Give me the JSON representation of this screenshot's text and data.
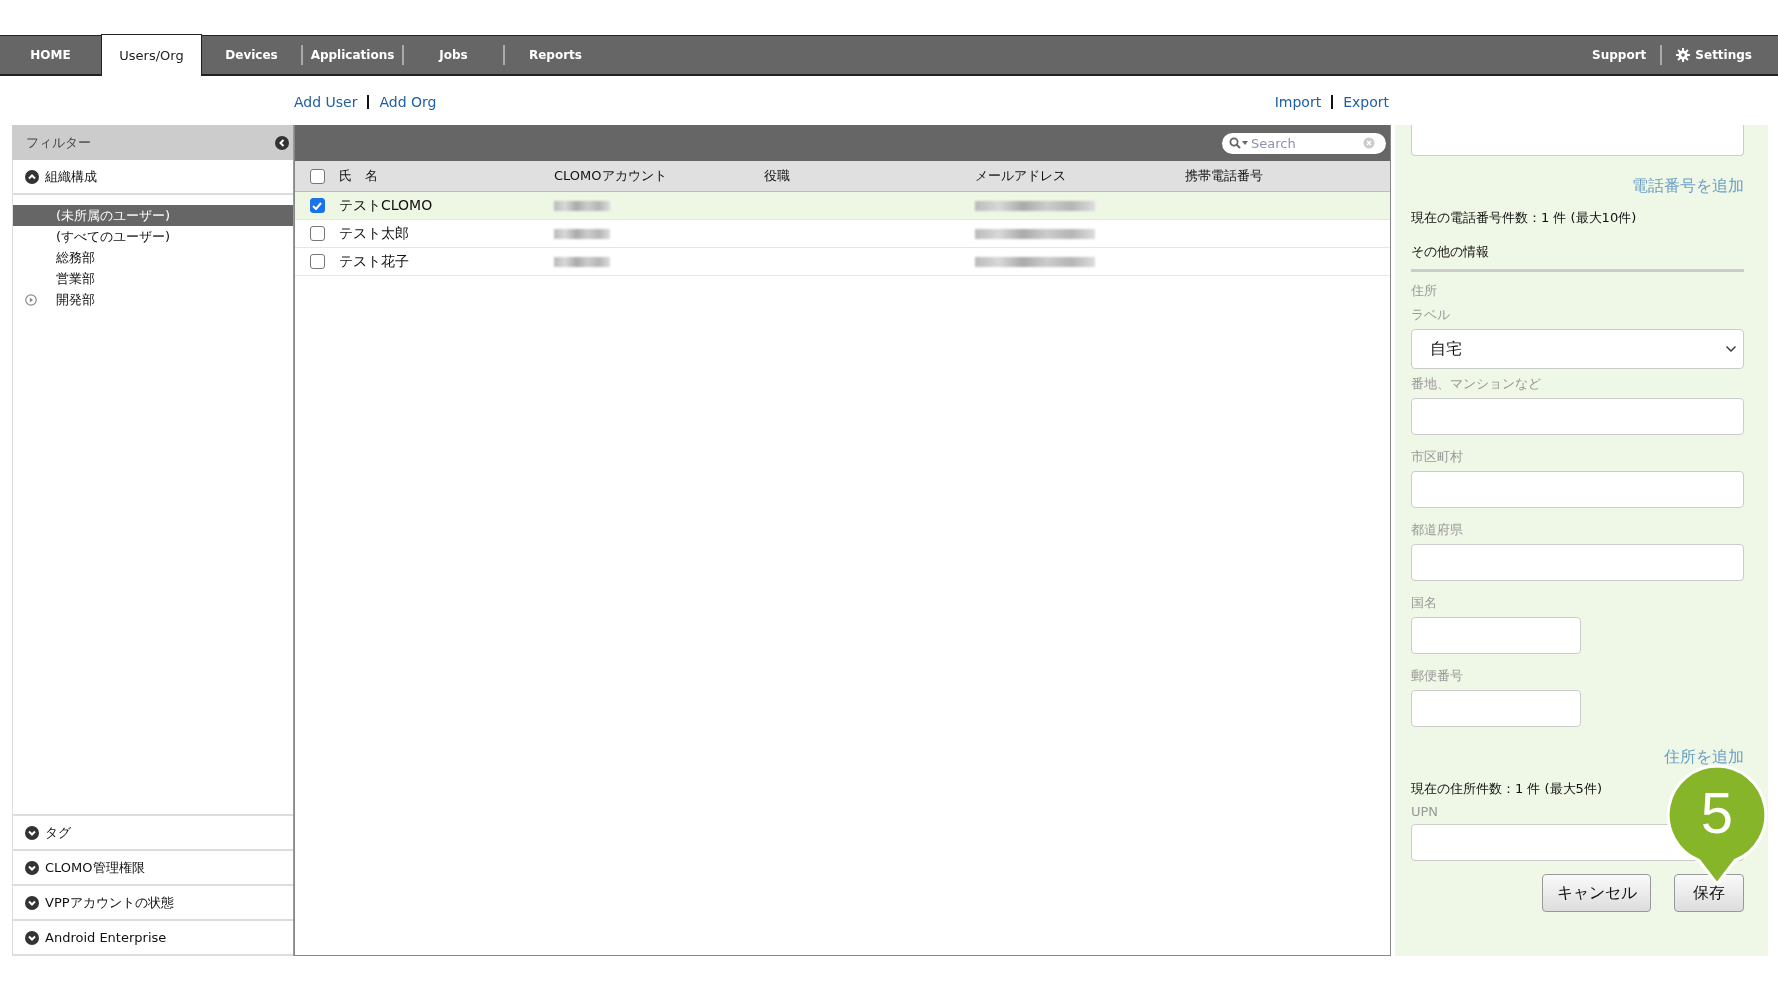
{
  "nav": {
    "tabs": [
      {
        "label": "HOME",
        "selected": false
      },
      {
        "label": "Users/Org",
        "selected": true
      },
      {
        "label": "Devices",
        "selected": false
      },
      {
        "label": "Applications",
        "selected": false
      },
      {
        "label": "Jobs",
        "selected": false
      },
      {
        "label": "Reports",
        "selected": false
      }
    ],
    "right": [
      {
        "label": "Support",
        "kind": "plain"
      },
      {
        "label": "Settings",
        "kind": "settings"
      }
    ]
  },
  "actions_left": [
    "Add User",
    "Add Org"
  ],
  "actions_right": [
    "Import",
    "Export"
  ],
  "filter": {
    "title": "フィルター",
    "sections": [
      {
        "label": "組織構成",
        "expanded": true,
        "items": [
          {
            "label": "(未所属のユーザー)",
            "selected": true,
            "expandable": false
          },
          {
            "label": "(すべてのユーザー)",
            "selected": false,
            "expandable": false
          },
          {
            "label": "総務部",
            "selected": false,
            "expandable": false
          },
          {
            "label": "営業部",
            "selected": false,
            "expandable": false
          },
          {
            "label": "開発部",
            "selected": false,
            "expandable": true
          }
        ]
      },
      {
        "label": "タグ",
        "expanded": false
      },
      {
        "label": "CLOMO管理権限",
        "expanded": false
      },
      {
        "label": "VPPアカウントの状態",
        "expanded": false
      },
      {
        "label": "Android Enterprise",
        "expanded": false
      }
    ]
  },
  "table": {
    "search": {
      "placeholder": "Search"
    },
    "all_checked": false,
    "columns": [
      "氏　名",
      "CLOMOアカウント",
      "役職",
      "メールアドレス",
      "携帯電話番号"
    ],
    "rows": [
      {
        "name": "テストCLOMO",
        "checked": true,
        "account_blurred": true,
        "email_blurred": true
      },
      {
        "name": "テスト太郎",
        "checked": false,
        "account_blurred": true,
        "email_blurred": true
      },
      {
        "name": "テスト花子",
        "checked": false,
        "account_blurred": true,
        "email_blurred": true
      }
    ]
  },
  "form": [
    {
      "kind": "partial_input"
    },
    {
      "kind": "link",
      "text": "電話番号を追加"
    },
    {
      "kind": "note",
      "text": "現在の電話番号件数：1 件 (最大10件)"
    },
    {
      "kind": "heading",
      "text": "その他の情報"
    },
    {
      "kind": "caption",
      "text": "住所"
    },
    {
      "kind": "label",
      "text": "ラベル"
    },
    {
      "kind": "select",
      "value": "自宅"
    },
    {
      "kind": "label",
      "text": "番地、マンションなど"
    },
    {
      "kind": "input"
    },
    {
      "kind": "label",
      "text": "市区町村"
    },
    {
      "kind": "input"
    },
    {
      "kind": "label",
      "text": "都道府県"
    },
    {
      "kind": "input"
    },
    {
      "kind": "label",
      "text": "国名"
    },
    {
      "kind": "short_input"
    },
    {
      "kind": "label",
      "text": "郵便番号"
    },
    {
      "kind": "short_input"
    },
    {
      "kind": "link",
      "text": "住所を追加"
    },
    {
      "kind": "note",
      "text": "現在の住所件数：1 件 (最大5件)"
    },
    {
      "kind": "label",
      "text": "UPN"
    },
    {
      "kind": "input"
    },
    {
      "kind": "buttons",
      "items": [
        "キャンセル",
        "保存"
      ]
    }
  ],
  "step_badge": "5"
}
